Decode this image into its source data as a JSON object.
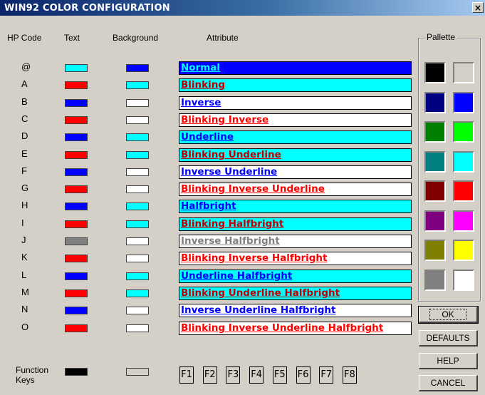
{
  "window": {
    "title": "WIN92 COLOR CONFIGURATION",
    "close_label": "×"
  },
  "headers": {
    "hp_code": "HP Code",
    "text": "Text",
    "background": "Background",
    "attribute": "Attribute"
  },
  "rows": [
    {
      "code": "@",
      "text_color": "#00ffff",
      "bg_color": "#0000ff",
      "attr": "Normal",
      "attr_fg": "#00ffff",
      "attr_bg": "#0000ff"
    },
    {
      "code": "A",
      "text_color": "#ff0000",
      "bg_color": "#00ffff",
      "attr": "Blinking",
      "attr_fg": "#c00000",
      "attr_bg": "#00ffff"
    },
    {
      "code": "B",
      "text_color": "#0000ff",
      "bg_color": "#ffffff",
      "attr": "Inverse",
      "attr_fg": "#0000ff",
      "attr_bg": "#ffffff"
    },
    {
      "code": "C",
      "text_color": "#ff0000",
      "bg_color": "#ffffff",
      "attr": "Blinking Inverse",
      "attr_fg": "#ff0000",
      "attr_bg": "#ffffff"
    },
    {
      "code": "D",
      "text_color": "#0000ff",
      "bg_color": "#00ffff",
      "attr": "Underline",
      "attr_fg": "#0000ff",
      "attr_bg": "#00ffff"
    },
    {
      "code": "E",
      "text_color": "#ff0000",
      "bg_color": "#00ffff",
      "attr": "Blinking Underline",
      "attr_fg": "#c00000",
      "attr_bg": "#00ffff"
    },
    {
      "code": "F",
      "text_color": "#0000ff",
      "bg_color": "#ffffff",
      "attr": "Inverse Underline",
      "attr_fg": "#0000ff",
      "attr_bg": "#ffffff"
    },
    {
      "code": "G",
      "text_color": "#ff0000",
      "bg_color": "#ffffff",
      "attr": "Blinking Inverse Underline",
      "attr_fg": "#ff0000",
      "attr_bg": "#ffffff"
    },
    {
      "code": "H",
      "text_color": "#0000ff",
      "bg_color": "#00ffff",
      "attr": "Halfbright",
      "attr_fg": "#0000ff",
      "attr_bg": "#00ffff"
    },
    {
      "code": "I",
      "text_color": "#ff0000",
      "bg_color": "#00ffff",
      "attr": "Blinking Halfbright",
      "attr_fg": "#c00000",
      "attr_bg": "#00ffff"
    },
    {
      "code": "J",
      "text_color": "#808080",
      "bg_color": "#ffffff",
      "attr": "Inverse Halfbright",
      "attr_fg": "#808080",
      "attr_bg": "#ffffff"
    },
    {
      "code": "K",
      "text_color": "#ff0000",
      "bg_color": "#ffffff",
      "attr": "Blinking Inverse Halfbright",
      "attr_fg": "#ff0000",
      "attr_bg": "#ffffff"
    },
    {
      "code": "L",
      "text_color": "#0000ff",
      "bg_color": "#00ffff",
      "attr": "Underline Halfbright",
      "attr_fg": "#0000ff",
      "attr_bg": "#00ffff"
    },
    {
      "code": "M",
      "text_color": "#ff0000",
      "bg_color": "#00ffff",
      "attr": "Blinking Underline Halfbright",
      "attr_fg": "#c00000",
      "attr_bg": "#00ffff"
    },
    {
      "code": "N",
      "text_color": "#0000ff",
      "bg_color": "#ffffff",
      "attr": "Inverse Underline Halfbright",
      "attr_fg": "#0000ff",
      "attr_bg": "#ffffff"
    },
    {
      "code": "O",
      "text_color": "#ff0000",
      "bg_color": "#ffffff",
      "attr": "Blinking Inverse Underline Halfbright",
      "attr_fg": "#ff0000",
      "attr_bg": "#ffffff"
    }
  ],
  "function_keys": {
    "label_line1": "Function",
    "label_line2": "Keys",
    "text_color": "#000000",
    "bg_color": "#d4d0c8",
    "keys": [
      "F1",
      "F2",
      "F3",
      "F4",
      "F5",
      "F6",
      "F7",
      "F8"
    ]
  },
  "palette": {
    "label": "Pallette",
    "colors": [
      "#000000",
      "#d4d0c8",
      "#000080",
      "#0000ff",
      "#008000",
      "#00ff00",
      "#008080",
      "#00ffff",
      "#800000",
      "#ff0000",
      "#800080",
      "#ff00ff",
      "#808000",
      "#ffff00",
      "#808080",
      "#ffffff"
    ]
  },
  "buttons": {
    "ok": "OK",
    "defaults": "DEFAULTS",
    "help": "HELP",
    "cancel": "CANCEL"
  }
}
